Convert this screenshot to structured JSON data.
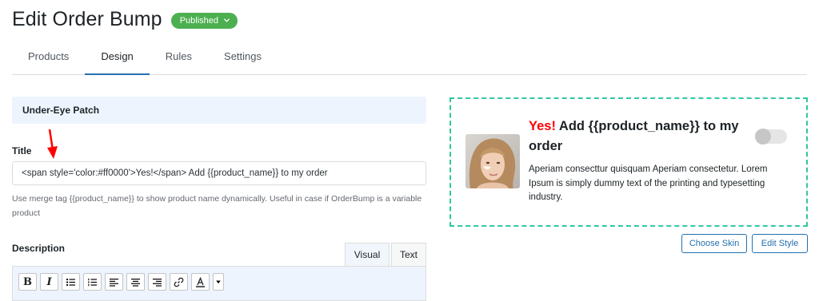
{
  "header": {
    "title": "Edit Order Bump",
    "status": "Published"
  },
  "tabs": [
    {
      "label": "Products"
    },
    {
      "label": "Design"
    },
    {
      "label": "Rules"
    },
    {
      "label": "Settings"
    }
  ],
  "active_tab": "Design",
  "product": {
    "name": "Under-Eye Patch"
  },
  "title_field": {
    "label": "Title",
    "value": "<span style='color:#ff0000'>Yes!</span> Add {{product_name}} to my order",
    "help": "Use merge tag {{product_name}} to show product name dynamically. Useful in case if OrderBump is a variable product"
  },
  "description_field": {
    "label": "Description",
    "tab_visual": "Visual",
    "tab_text": "Text",
    "toolbar": [
      "bold-icon",
      "italic-icon",
      "bullet-list-icon",
      "numbered-list-icon",
      "align-left-icon",
      "align-center-icon",
      "align-right-icon",
      "link-icon",
      "text-color-icon",
      "dropdown-arrow-icon"
    ]
  },
  "preview": {
    "title_highlight": "Yes!",
    "title_rest": " Add {{product_name}} to my order",
    "description": "Aperiam consecttur quisquam Aperiam consectetur. Lorem Ipsum is simply dummy text of the printing and typesetting industry.",
    "border_color": "#2ec9a0",
    "highlight_color": "#ff0000"
  },
  "actions": {
    "choose_skin": "Choose Skin",
    "edit_style": "Edit Style"
  },
  "colors": {
    "accent": "#2271b1",
    "published": "#4caf50",
    "arrow": "#ff0000"
  }
}
